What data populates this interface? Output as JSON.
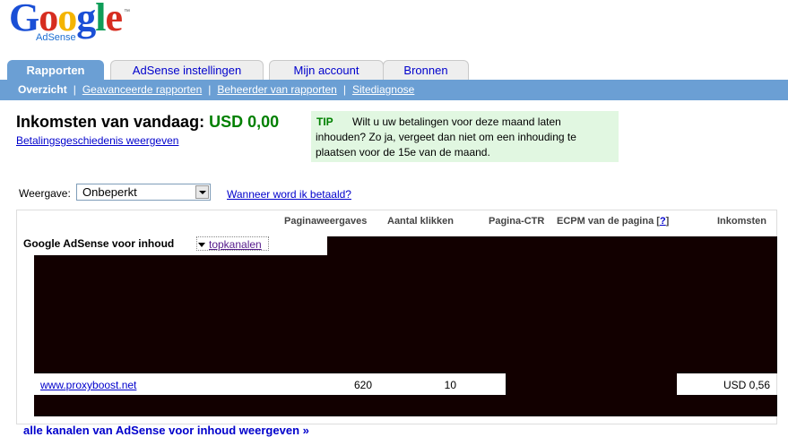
{
  "logo": {
    "word": [
      "G",
      "o",
      "o",
      "g",
      "l",
      "e"
    ],
    "word_colors": [
      "#1a4fd6",
      "#d62d20",
      "#f4b400",
      "#1a4fd6",
      "#0f9d58",
      "#d62d20"
    ],
    "sub": "AdSense",
    "tm": "™"
  },
  "tabs": [
    {
      "label": "Rapporten",
      "active": true
    },
    {
      "label": "AdSense instellingen",
      "active": false
    },
    {
      "label": "Mijn account",
      "active": false
    },
    {
      "label": "Bronnen",
      "active": false
    }
  ],
  "subnav": [
    {
      "label": "Overzicht",
      "current": true
    },
    {
      "label": "Geavanceerde rapporten",
      "current": false
    },
    {
      "label": "Beheerder van rapporten",
      "current": false
    },
    {
      "label": "Sitediagnose",
      "current": false
    }
  ],
  "subnav_separator": "|",
  "earnings": {
    "title": "Inkomsten van vandaag:",
    "amount": "USD 0,00",
    "history_link": "Betalingsgeschiedenis weergeven"
  },
  "tip": {
    "label": "TIP",
    "text": "Wilt u uw betalingen voor deze maand laten inhouden? Zo ja, vergeet dan niet om een inhouding te plaatsen voor de 15e van de maand."
  },
  "view": {
    "label": "Weergave:",
    "selected": "Onbeperkt",
    "when_paid_link": "Wanneer word ik betaald?"
  },
  "report": {
    "columns": {
      "pageviews": "Paginaweergaves",
      "clicks": "Aantal klikken",
      "ctr": "Pagina-CTR",
      "ecpm": "ECPM van de pagina",
      "ecpm_help": "?",
      "earnings": "Inkomsten"
    },
    "section_title": "Google AdSense voor inhoud",
    "section_dropdown": "topkanalen",
    "row": {
      "channel": "www.proxyboost.net",
      "pageviews": "620",
      "clicks": "10",
      "earnings": "USD 0,56"
    },
    "all_channels_link": "alle kanalen van AdSense voor inhoud weergeven »"
  }
}
